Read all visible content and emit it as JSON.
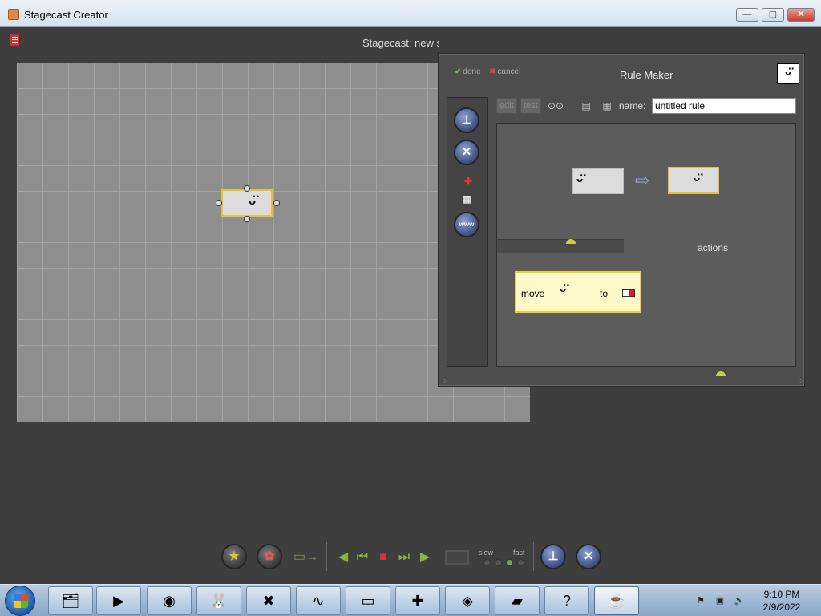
{
  "window": {
    "title": "Stagecast Creator",
    "min_label": "—",
    "max_label": "▢",
    "close_label": "✕"
  },
  "workspace": {
    "document_title": "Stagecast: new s"
  },
  "rule_maker": {
    "done_label": "done",
    "cancel_label": "cancel",
    "title": "Rule Maker",
    "toolbar": {
      "edit_label": "edit",
      "test_label": "test",
      "name_label": "name:"
    },
    "rule_name": "untitled rule",
    "actions_label": "actions",
    "action": {
      "verb": "move",
      "preposition": "to"
    },
    "colors": {
      "selection_border": "#e3c23a",
      "action_card_bg": "#fff8c8",
      "arrow": "#9aa5d6"
    }
  },
  "controls": {
    "speed_slow": "slow",
    "speed_fast": "fast"
  },
  "taskbar": {
    "apps": [
      "file-explorer-icon",
      "media-player-icon",
      "chrome-icon",
      "rabbit-app-icon",
      "tool-app-icon",
      "oscilloscope-icon",
      "command-prompt-icon",
      "puzzle-app-icon",
      "media-app-icon",
      "notes-app-icon",
      "help-book-icon",
      "java-icon"
    ],
    "clock": {
      "time": "9:10 PM",
      "date": "2/9/2022"
    }
  }
}
